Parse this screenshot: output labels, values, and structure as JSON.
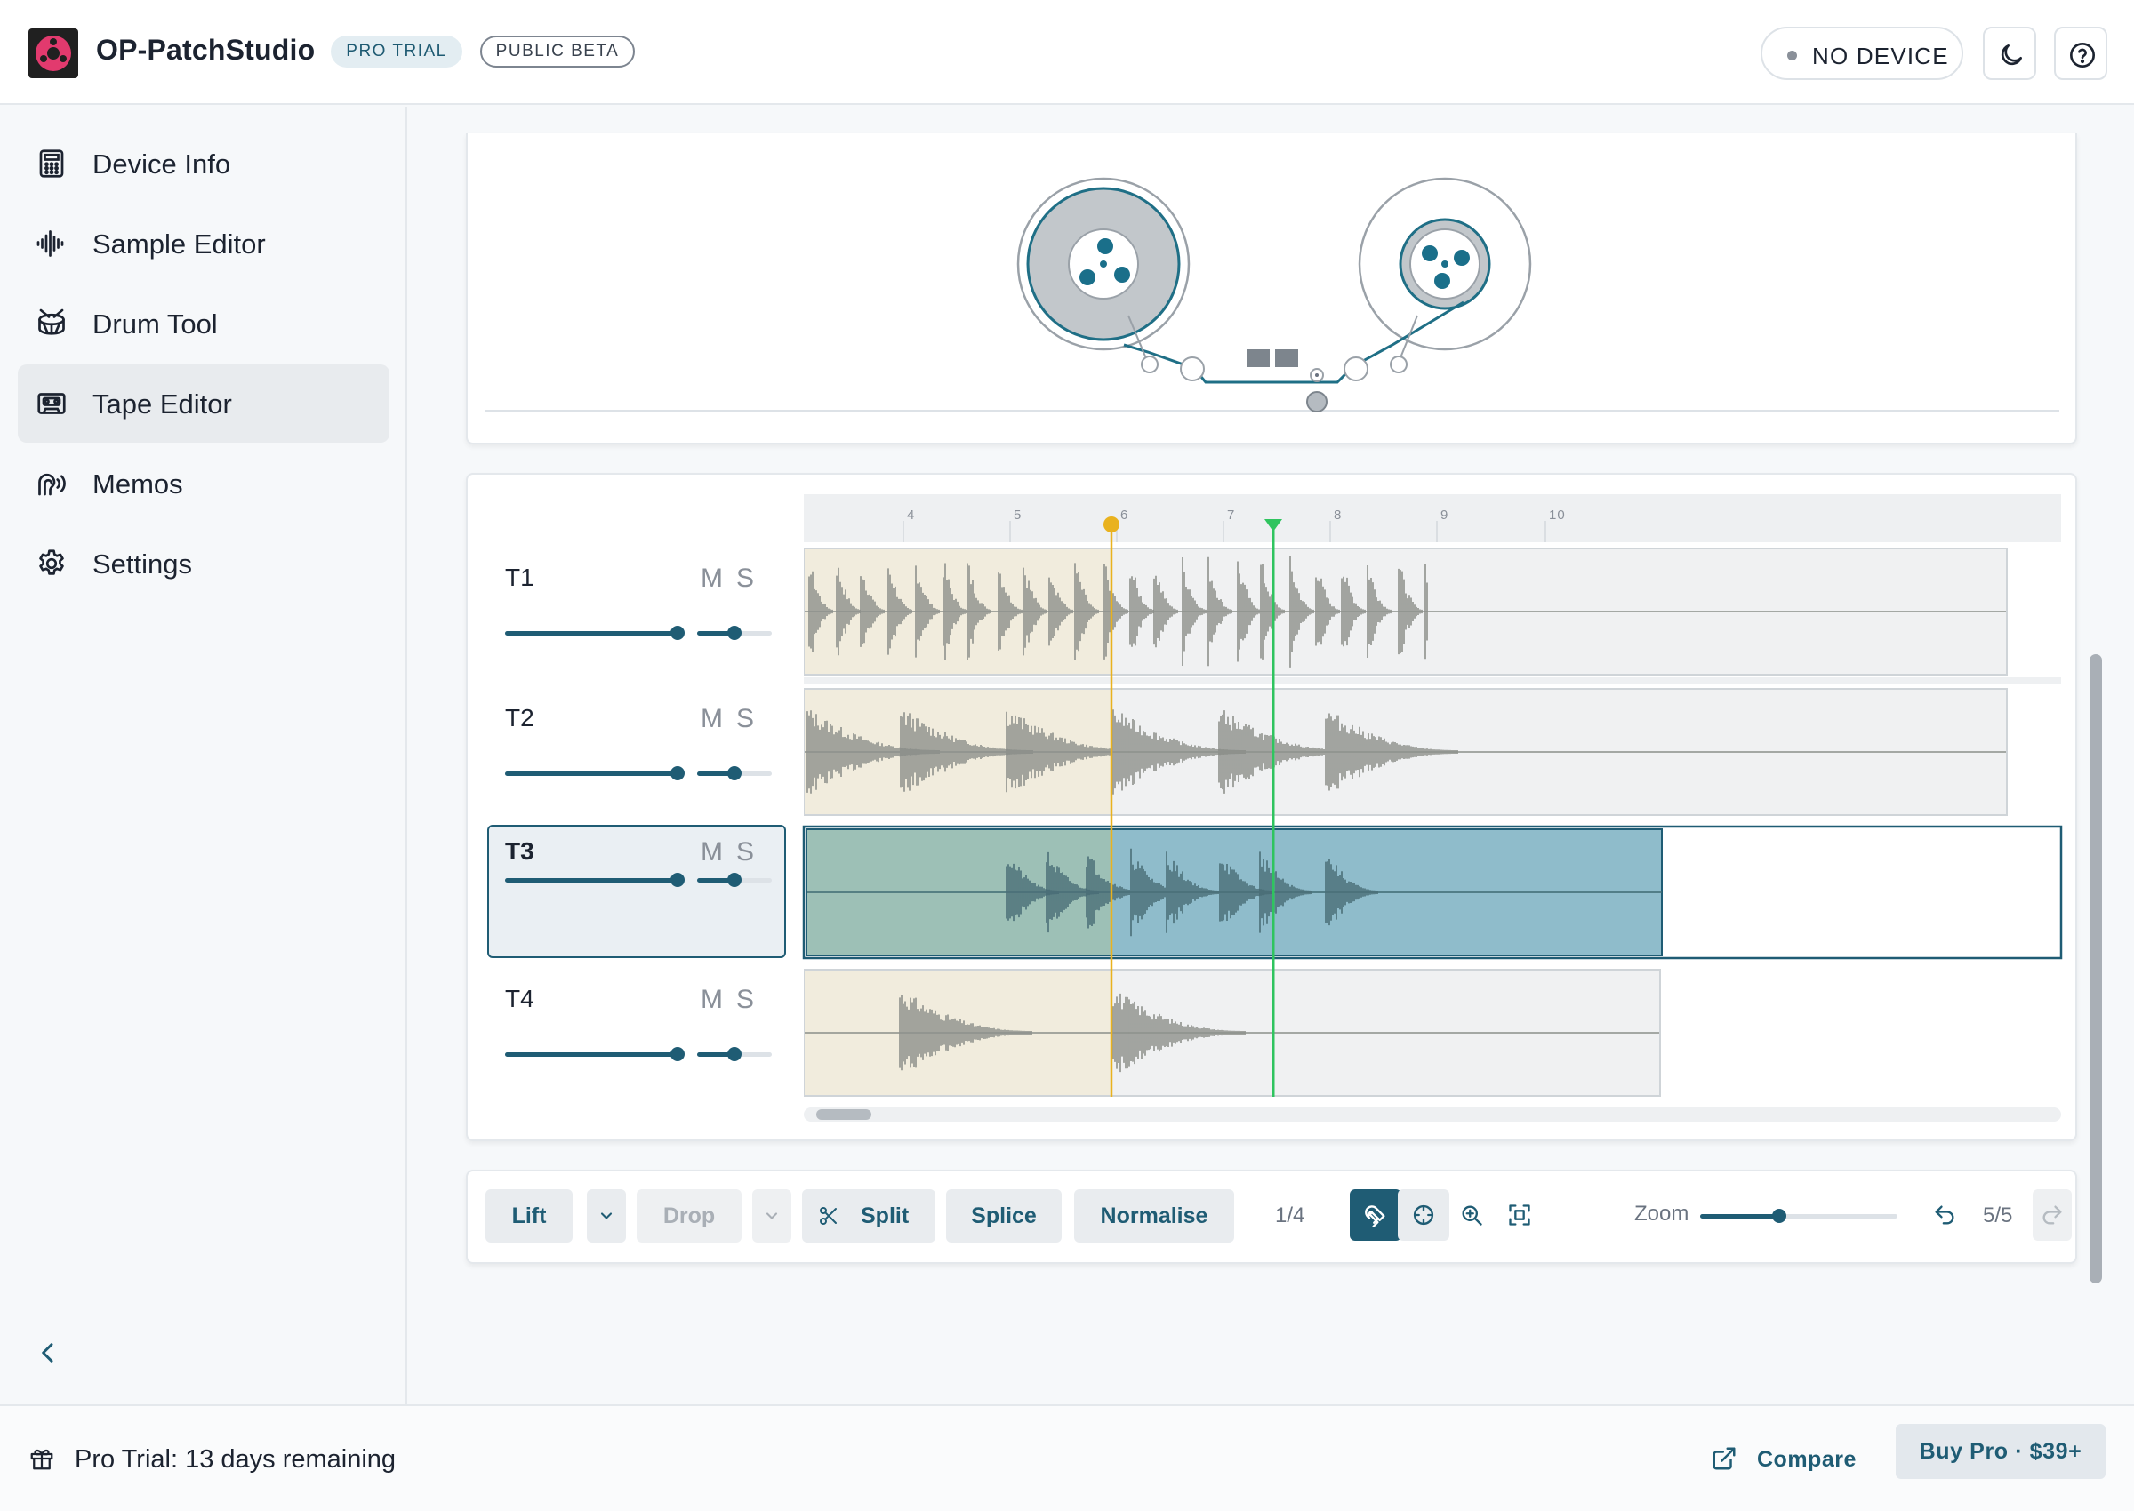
{
  "header": {
    "app_title": "OP-PatchStudio",
    "badge_trial": "PRO TRIAL",
    "badge_beta": "PUBLIC BETA",
    "device_status": "NO DEVICE"
  },
  "sidebar": {
    "items": [
      {
        "label": "Device Info",
        "icon": "calculator-icon"
      },
      {
        "label": "Sample Editor",
        "icon": "waveform-icon"
      },
      {
        "label": "Drum Tool",
        "icon": "drum-icon"
      },
      {
        "label": "Tape Editor",
        "icon": "cassette-icon",
        "active": true
      },
      {
        "label": "Memos",
        "icon": "voice-memo-icon"
      },
      {
        "label": "Settings",
        "icon": "gear-icon"
      }
    ]
  },
  "timeline": {
    "ruler": [
      "4",
      "5",
      "6",
      "7",
      "8",
      "9",
      "10"
    ],
    "tracks": [
      {
        "name": "T1",
        "mute": "M",
        "solo": "S",
        "volume": 0.99,
        "pan": 0.5
      },
      {
        "name": "T2",
        "mute": "M",
        "solo": "S",
        "volume": 0.99,
        "pan": 0.5
      },
      {
        "name": "T3",
        "mute": "M",
        "solo": "S",
        "volume": 0.99,
        "pan": 0.5,
        "selected": true
      },
      {
        "name": "T4",
        "mute": "M",
        "solo": "S",
        "volume": 0.99,
        "pan": 0.5
      }
    ],
    "colors": {
      "loop_marker": "#e9b21f",
      "playhead": "#2fc45f",
      "selected_clip": "#7fb3c3",
      "accent": "#1f5c74"
    }
  },
  "toolbar": {
    "lift": "Lift",
    "drop": "Drop",
    "split": "Split",
    "splice": "Splice",
    "normalise": "Normalise",
    "track_counter": "1/4",
    "zoom_label": "Zoom",
    "zoom_level": 0.4,
    "history_counter": "5/5"
  },
  "footer": {
    "trial_text": "Pro Trial: 13 days remaining",
    "compare": "Compare",
    "buy": "Buy Pro · $39+"
  }
}
